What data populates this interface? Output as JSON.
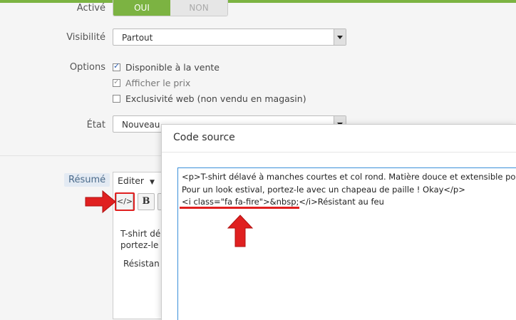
{
  "form": {
    "active_label": "Activé",
    "toggle_yes": "OUI",
    "toggle_no": "NON",
    "visibility_label": "Visibilité",
    "visibility_value": "Partout",
    "options_label": "Options",
    "options": [
      {
        "label": "Disponible à la vente",
        "checked": true
      },
      {
        "label": "Afficher le prix",
        "checked": true
      },
      {
        "label": "Exclusivité web (non vendu en magasin)",
        "checked": false
      }
    ],
    "state_label": "État",
    "state_value": "Nouveau",
    "summary_label": "Résumé"
  },
  "editor": {
    "menu_label": "Editer",
    "source_button": "</>",
    "bold_button": "B",
    "content_line1": "T-shirt dél",
    "content_line2": "portez-le a",
    "content_line3": "Résistan"
  },
  "modal": {
    "title": "Code source",
    "code_lines": [
      "<p>T-shirt délavé à manches courtes et col rond. Matière douce et extensible pour un",
      "Pour un look estival, portez-le avec un chapeau de paille ! Okay</p>",
      "<i class=\"fa fa-fire\">&nbsp;</i>Résistant au feu"
    ]
  },
  "colors": {
    "accent_green": "#7cb342",
    "annotation_red": "#e02020",
    "focus_blue": "#3b8fd9"
  }
}
